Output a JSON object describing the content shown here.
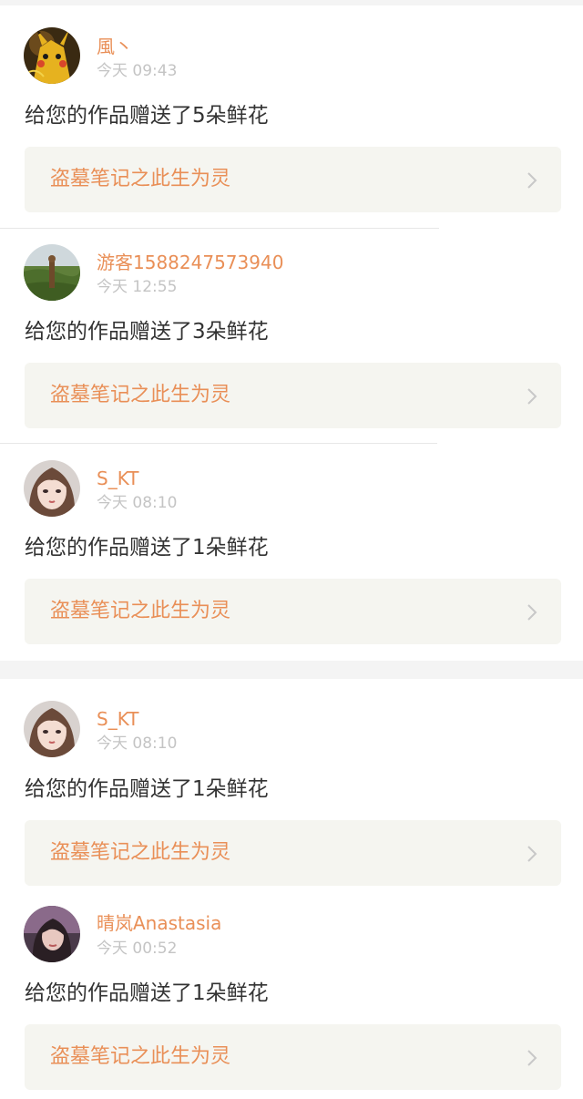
{
  "notifications": [
    {
      "username": "風丶",
      "timestamp": "今天 09:43",
      "gift_text": "给您的作品赠送了5朵鲜花",
      "work_title": "盗墓笔记之此生为灵",
      "avatar_icon": "pikachu-avatar-icon"
    },
    {
      "username": "游客1588247573940",
      "timestamp": "今天 12:55",
      "gift_text": "给您的作品赠送了3朵鲜花",
      "work_title": "盗墓笔记之此生为灵",
      "avatar_icon": "field-landscape-avatar-icon"
    },
    {
      "username": "S_KT",
      "timestamp": "今天 08:10",
      "gift_text": "给您的作品赠送了1朵鲜花",
      "work_title": "盗墓笔记之此生为灵",
      "avatar_icon": "anime-girl-avatar-icon"
    },
    {
      "username": "S_KT",
      "timestamp": "今天 08:10",
      "gift_text": "给您的作品赠送了1朵鲜花",
      "work_title": "盗墓笔记之此生为灵",
      "avatar_icon": "anime-girl-avatar-icon"
    },
    {
      "username": "晴岚Anastasia",
      "timestamp": "今天 00:52",
      "gift_text": "给您的作品赠送了1朵鲜花",
      "work_title": "盗墓笔记之此生为灵",
      "avatar_icon": "portrait-girl-avatar-icon"
    }
  ],
  "colors": {
    "accent": "#e98f57",
    "timestamp": "#c4c4c4",
    "body_text": "#333333",
    "link_background": "#f5f5f0",
    "chevron": "#c8c8c8"
  },
  "icons": {
    "chevron": "chevron-right-icon"
  }
}
